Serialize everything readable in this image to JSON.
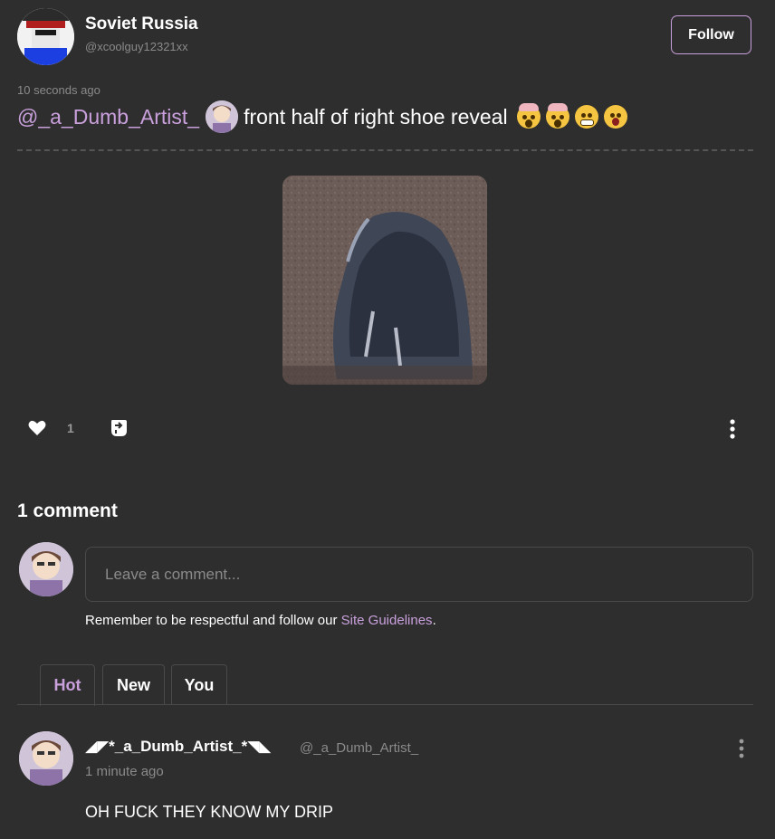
{
  "post": {
    "author_name": "Soviet Russia",
    "author_handle": "@xcoolguy12321xx",
    "follow_label": "Follow",
    "time": "10 seconds ago",
    "mention": "@_a_Dumb_Artist_",
    "text": "front half of right shoe reveal",
    "emojis": [
      "exploding-head-emoji",
      "exploding-head-emoji",
      "grimacing-face-emoji",
      "astonished-face-emoji"
    ],
    "image_description_icon": "shoe-photo",
    "like_count": "1"
  },
  "comments_section": {
    "heading": "1 comment",
    "input_placeholder": "Leave a comment...",
    "guidelines_prefix": "Remember to be respectful and follow our ",
    "guidelines_link": "Site Guidelines",
    "guidelines_suffix": ".",
    "tabs": [
      {
        "label": "Hot",
        "active": true
      },
      {
        "label": "New",
        "active": false
      },
      {
        "label": "You",
        "active": false
      }
    ]
  },
  "comments": [
    {
      "display_name": "◢◤*_a_Dumb_Artist_*◥◣",
      "handle": "@_a_Dumb_Artist_",
      "time": "1 minute ago",
      "body": "OH FUCK  THEY KNOW MY DRIP"
    }
  ],
  "colors": {
    "background": "#2e2e2e",
    "accent": "#c9a0dc",
    "muted": "#8a8a8a"
  }
}
